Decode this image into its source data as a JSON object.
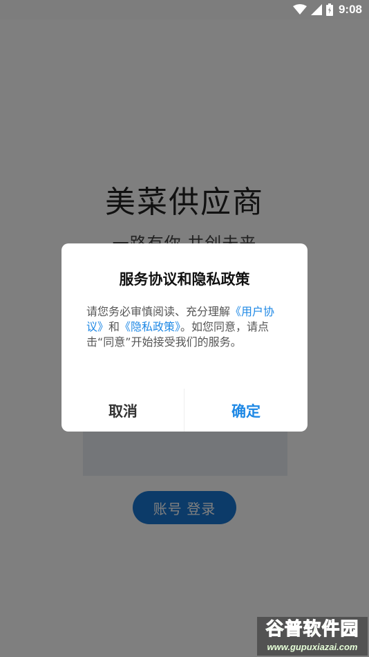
{
  "status_bar": {
    "time": "9:08",
    "icons": [
      "wifi-icon",
      "signal-icon",
      "battery-icon"
    ]
  },
  "app": {
    "title": "美菜供应商",
    "slogan": "一路有你 共创未来",
    "login_button": "账号 登录"
  },
  "dialog": {
    "title": "服务协议和隐私政策",
    "body_part1": "请您务必审慎阅读、充分理解",
    "link_user_agreement": "《用户协议》",
    "body_and": "和",
    "link_privacy_policy": "《隐私政策》",
    "body_part2": "。如您同意，请点击“同意”开始接受我们的服务。",
    "cancel_label": "取消",
    "confirm_label": "确定"
  },
  "watermark": {
    "title": "谷普软件园",
    "url": "www.gupuxiazai.com"
  },
  "colors": {
    "accent": "#1e88e5",
    "login_button": "#1976d2",
    "overlay": "rgba(0,0,0,0.5)"
  }
}
